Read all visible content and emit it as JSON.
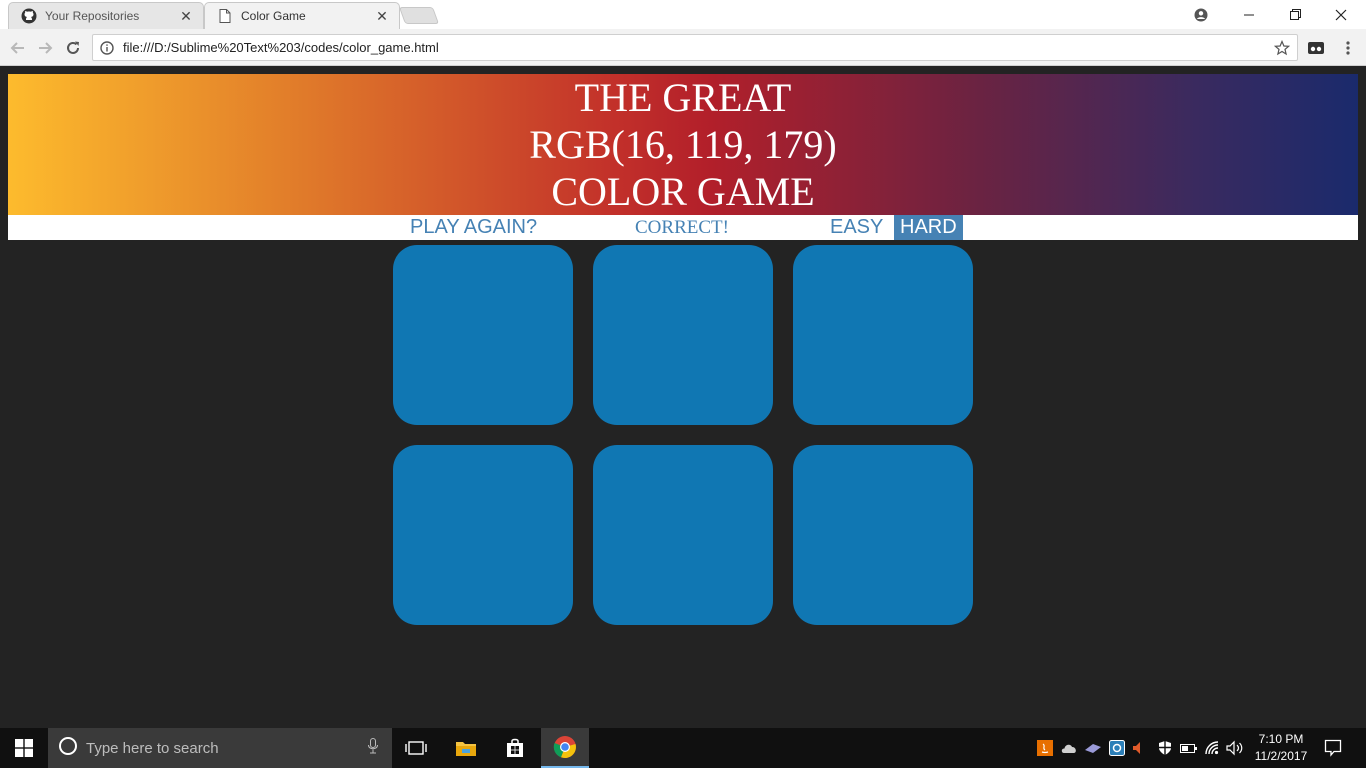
{
  "browser": {
    "tabs": [
      {
        "title": "Your Repositories",
        "icon": "github-icon",
        "active": false
      },
      {
        "title": "Color Game",
        "icon": "page-icon",
        "active": true
      }
    ],
    "address": "file:///D:/Sublime%20Text%203/codes/color_game.html"
  },
  "game": {
    "header": {
      "line1": "THE GREAT",
      "rgb": "RGB(16, 119, 179)",
      "line3": "COLOR GAME"
    },
    "stripe": {
      "reset_label": "PLAY AGAIN?",
      "message": "CORRECT!",
      "easy_label": "EASY",
      "hard_label": "HARD",
      "selected_mode": "HARD"
    },
    "colors": {
      "stripe_text": "#4682b4",
      "background": "#232323",
      "square": "#1077b3"
    },
    "squares": [
      "rgb(16, 119, 179)",
      "rgb(16, 119, 179)",
      "rgb(16, 119, 179)",
      "rgb(16, 119, 179)",
      "rgb(16, 119, 179)",
      "rgb(16, 119, 179)"
    ]
  },
  "taskbar": {
    "search_placeholder": "Type here to search",
    "time": "7:10 PM",
    "date": "11/2/2017"
  }
}
